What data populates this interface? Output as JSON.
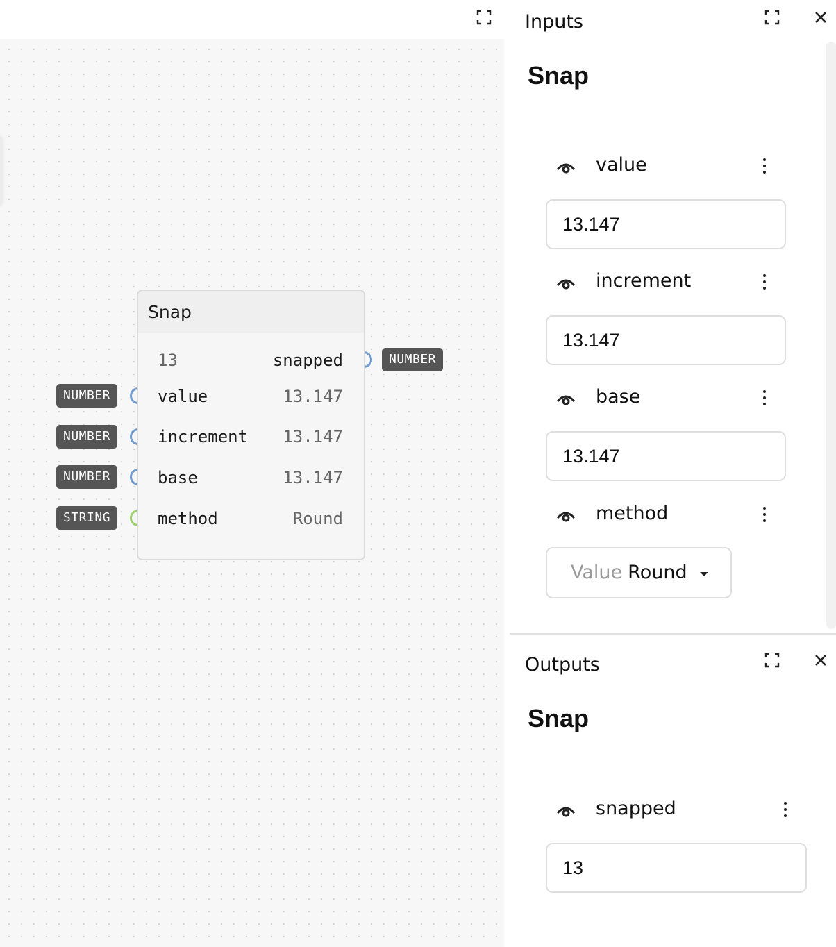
{
  "canvas": {
    "node": {
      "title": "Snap",
      "output": {
        "value": "13",
        "label": "snapped",
        "type": "NUMBER"
      },
      "inputs": [
        {
          "type": "NUMBER",
          "label": "value",
          "value": "13.147"
        },
        {
          "type": "NUMBER",
          "label": "increment",
          "value": "13.147"
        },
        {
          "type": "NUMBER",
          "label": "base",
          "value": "13.147"
        },
        {
          "type": "STRING",
          "label": "method",
          "value": "Round"
        }
      ]
    }
  },
  "inputs_panel": {
    "header": "Inputs",
    "title": "Snap",
    "fields": [
      {
        "label": "value",
        "value": "13.147"
      },
      {
        "label": "increment",
        "value": "13.147"
      },
      {
        "label": "base",
        "value": "13.147"
      },
      {
        "label": "method",
        "select_label": "Value",
        "select_value": "Round"
      }
    ]
  },
  "outputs_panel": {
    "header": "Outputs",
    "title": "Snap",
    "fields": [
      {
        "label": "snapped",
        "value": "13"
      }
    ]
  },
  "colors": {
    "number_port": "#6f9bd1",
    "string_port": "#9bd16b",
    "type_tag": "#555555",
    "canvas_bg": "#f7f7f7"
  },
  "icons": [
    "expand-icon",
    "close-icon",
    "eye-icon",
    "kebab-menu-icon",
    "caret-down-icon"
  ]
}
